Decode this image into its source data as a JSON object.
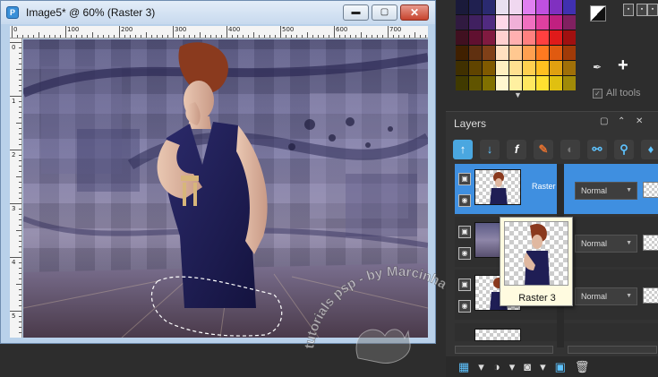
{
  "window": {
    "title": "Image5* @  60% (Raster 3)",
    "app_icon": "psp-icon",
    "buttons": {
      "minimize": "▬",
      "maximize": "▢",
      "close": "✕"
    }
  },
  "ruler": {
    "top_labels": [
      "0",
      "100",
      "200",
      "300",
      "400",
      "500",
      "600",
      "700"
    ],
    "left_labels": [
      "0",
      "1",
      "2",
      "3",
      "4",
      "5"
    ]
  },
  "palette": {
    "colors": [
      "#1a1a3a",
      "#202050",
      "#2a2a70",
      "#e8e0f0",
      "#f0d8f0",
      "#e080f0",
      "#c050e0",
      "#8030c0",
      "#4030b0",
      "#301a40",
      "#402060",
      "#502a80",
      "#ffd8e8",
      "#f0b0d8",
      "#f070c0",
      "#e040a0",
      "#c02080",
      "#802060",
      "#401020",
      "#601030",
      "#801a40",
      "#ffd0d0",
      "#ffb0b0",
      "#ff8080",
      "#ff4040",
      "#e01a1a",
      "#a01010",
      "#402000",
      "#603010",
      "#804018",
      "#ffe0c0",
      "#ffc890",
      "#ffa050",
      "#ff7a20",
      "#e05a10",
      "#a03a08",
      "#403000",
      "#604400",
      "#805a00",
      "#fff0c0",
      "#ffe090",
      "#ffd050",
      "#ffc020",
      "#e0a010",
      "#a07008",
      "#403a00",
      "#605400",
      "#807000",
      "#fff8d0",
      "#fff0a0",
      "#ffe860",
      "#ffe030",
      "#e0c010",
      "#a08a08"
    ],
    "all_tools_label": "All tools",
    "fg_bg_icon": "fg-bg-swatch-icon",
    "eyedropper_icon": "eyedropper-icon",
    "add_icon": "plus-icon"
  },
  "layers": {
    "title": "Layers",
    "items": [
      {
        "name": "Raster 3",
        "blend": "Normal",
        "selected": true
      },
      {
        "name": "",
        "blend": "Normal",
        "selected": false
      },
      {
        "name": "",
        "blend": "Normal",
        "selected": false
      }
    ],
    "tooltip_label": "Raster 3"
  },
  "watermark_text": "tutorials psp - by Marcinha"
}
